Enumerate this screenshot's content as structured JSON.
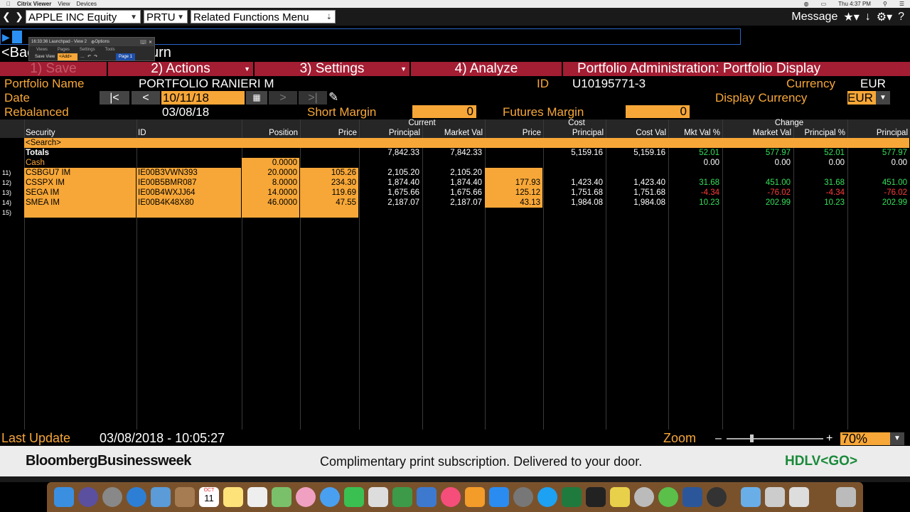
{
  "menubar": {
    "app": "Citrix Viewer",
    "items": [
      "View",
      "Devices"
    ],
    "clock": "Thu 4:37 PM"
  },
  "toolbar": {
    "security": "APPLE INC Equity",
    "function": "PRTU",
    "related": "Related Functions  Menu",
    "message": "Message"
  },
  "launchpad": {
    "title": "16:33:36 Launchpad - View 2",
    "options": "Options",
    "tabs": [
      "Views",
      "Pages",
      "Settings",
      "Tools"
    ],
    "save": "Save View",
    "add": "<Add>",
    "page": "Page 1"
  },
  "back": "<Back",
  "back_tail": "urn",
  "menu": {
    "save": "1) Save",
    "actions": "2) Actions",
    "settings": "3) Settings",
    "analyze": "4) Analyze",
    "title": "Portfolio Administration: Portfolio Display"
  },
  "info": {
    "portfolio_label": "Portfolio Name",
    "portfolio_value": "PORTFOLIO RANIERI M",
    "id_label": "ID",
    "id_value": "U10195771-3",
    "currency_label": "Currency",
    "currency_value": "EUR",
    "date_label": "Date",
    "date_value": "10/11/18",
    "display_currency_label": "Display Currency",
    "display_currency_value": "EUR",
    "rebalanced_label": "Rebalanced",
    "rebalanced_value": "03/08/18",
    "short_margin_label": "Short Margin",
    "short_margin_value": "0",
    "futures_margin_label": "Futures Margin",
    "futures_margin_value": "0"
  },
  "table": {
    "group_headers": {
      "current": "Current",
      "cost": "Cost",
      "change": "Change"
    },
    "columns": [
      "Security",
      "ID",
      "Position",
      "Price",
      "Principal",
      "Market Val",
      "Price",
      "Principal",
      "Cost Val",
      "Mkt Val %",
      "Market Val",
      "Principal %",
      "Principal"
    ],
    "search": "<Search>",
    "totals": {
      "label": "Totals",
      "cur_principal": "7,842.33",
      "market_val": "7,842.33",
      "cost_principal": "5,159.16",
      "cost_val": "5,159.16",
      "mkt_pct": "52.01",
      "chg_market": "577.97",
      "chg_pct": "52.01",
      "chg_principal": "577.97"
    },
    "cash": {
      "label": "Cash",
      "position": "0.0000",
      "mkt_pct": "0.00",
      "chg_market": "0.00",
      "chg_pct": "0.00",
      "chg_principal": "0.00"
    },
    "rows": [
      {
        "n": "11)",
        "sec": "CSBGU7 IM",
        "id": "IE00B3VWN393",
        "pos": "20.0000",
        "price": "105.26",
        "cprin": "2,105.20",
        "mval": "2,105.20",
        "cprice": "",
        "costprin": "",
        "costval": "",
        "pct": "",
        "chgm": "",
        "chgp": "",
        "chgpr": "",
        "sign": ""
      },
      {
        "n": "12)",
        "sec": "CSSPX IM",
        "id": "IE00B5BMR087",
        "pos": "8.0000",
        "price": "234.30",
        "cprin": "1,874.40",
        "mval": "1,874.40",
        "cprice": "177.93",
        "costprin": "1,423.40",
        "costval": "1,423.40",
        "pct": "31.68",
        "chgm": "451.00",
        "chgp": "31.68",
        "chgpr": "451.00",
        "sign": "green"
      },
      {
        "n": "13)",
        "sec": "SEGA IM",
        "id": "IE00B4WXJJ64",
        "pos": "14.0000",
        "price": "119.69",
        "cprin": "1,675.66",
        "mval": "1,675.66",
        "cprice": "125.12",
        "costprin": "1,751.68",
        "costval": "1,751.68",
        "pct": "-4.34",
        "chgm": "-76.02",
        "chgp": "-4.34",
        "chgpr": "-76.02",
        "sign": "red"
      },
      {
        "n": "14)",
        "sec": "SMEA IM",
        "id": "IE00B4K48X80",
        "pos": "46.0000",
        "price": "47.55",
        "cprin": "2,187.07",
        "mval": "2,187.07",
        "cprice": "43.13",
        "costprin": "1,984.08",
        "costval": "1,984.08",
        "pct": "10.23",
        "chgm": "202.99",
        "chgp": "10.23",
        "chgpr": "202.99",
        "sign": "green"
      },
      {
        "n": "15)",
        "sec": "",
        "id": "",
        "pos": "",
        "price": "",
        "cprin": "",
        "mval": "",
        "cprice": "",
        "costprin": "",
        "costval": "",
        "pct": "",
        "chgm": "",
        "chgp": "",
        "chgpr": "",
        "sign": ""
      }
    ]
  },
  "status": {
    "last_update_label": "Last Update",
    "last_update_value": "03/08/2018 - 10:05:27",
    "zoom_label": "Zoom",
    "zoom_value": "70%"
  },
  "ad": {
    "brand": "BloombergBusinessweek",
    "text": "Complimentary print subscription. Delivered to your door.",
    "code": "HDLV<GO>"
  },
  "dock": {
    "calendar_month": "OCT",
    "calendar_day": "11"
  },
  "colors": {
    "orange": "#f7a738",
    "red_menu": "#a31d33",
    "green": "#33e05a",
    "negative": "#ff3b3b"
  }
}
